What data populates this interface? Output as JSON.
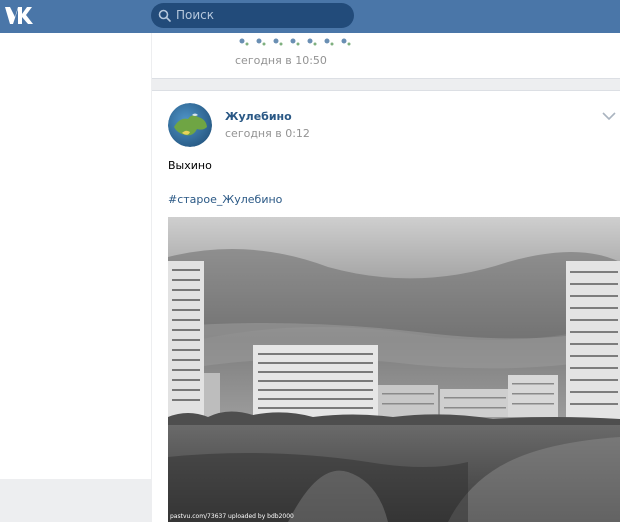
{
  "header": {
    "search_placeholder": "Поиск",
    "brand_color": "#4a76a8"
  },
  "previous_post": {
    "time": "сегодня в 10:50"
  },
  "post": {
    "author": "Жулебино",
    "time": "сегодня в 0:12",
    "text": "Выхино",
    "hashtag": "#старое_Жулебино",
    "photo_watermark": "pastvu.com/73637  uploaded by bdb2000"
  },
  "colors": {
    "link": "#2a5885",
    "muted": "#939393",
    "background": "#edeef0"
  },
  "icons": [
    "vk-logo-icon",
    "search-icon",
    "chevron-down-icon"
  ]
}
